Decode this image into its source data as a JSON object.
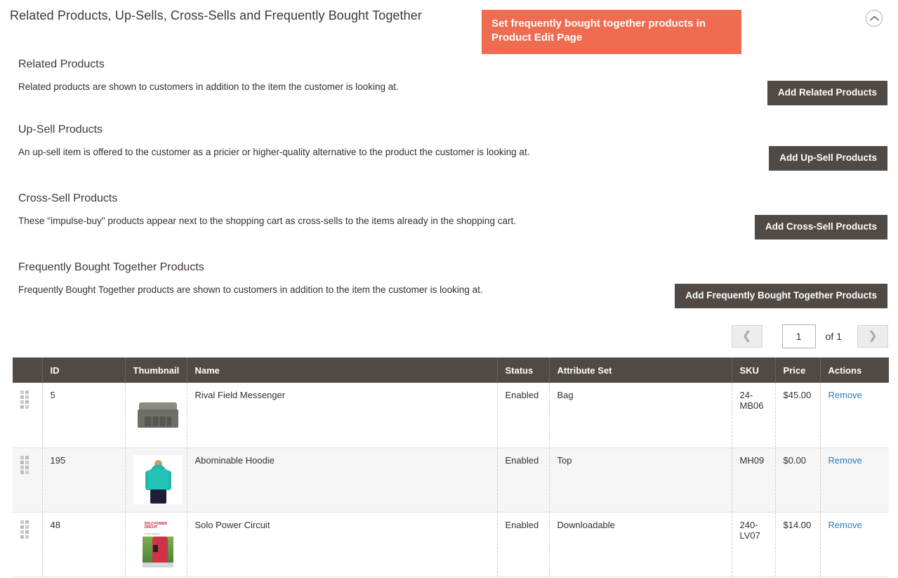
{
  "panel": {
    "title": "Related Products, Up-Sells, Cross-Sells and Frequently Bought Together",
    "collapse_icon": "chevron-up-circle-icon"
  },
  "callout": {
    "text": "Set frequently bought together products in Product Edit Page",
    "background": "#ef6c51",
    "text_color": "#ffffff"
  },
  "sections": [
    {
      "title": "Related Products",
      "description": "Related products are shown to customers in addition to the item the customer is looking at.",
      "button": "Add Related Products"
    },
    {
      "title": "Up-Sell Products",
      "description": "An up-sell item is offered to the customer as a pricier or higher-quality alternative to the product the customer is looking at.",
      "button": "Add Up-Sell Products"
    },
    {
      "title": "Cross-Sell Products",
      "description": "These \"impulse-buy\" products appear next to the shopping cart as cross-sells to the items already in the shopping cart.",
      "button": "Add Cross-Sell Products"
    },
    {
      "title": "Frequently Bought Together Products",
      "description": "Frequently Bought Together products are shown to customers in addition to the item the customer is looking at.",
      "button": "Add Frequently Bought Together Products"
    }
  ],
  "pagination": {
    "prev_icon": "chevron-left-icon",
    "next_icon": "chevron-right-icon",
    "current_page": "1",
    "of_label": "of 1",
    "total_pages": "1"
  },
  "table": {
    "columns": [
      "",
      "ID",
      "Thumbnail",
      "Name",
      "Status",
      "Attribute Set",
      "SKU",
      "Price",
      "Actions"
    ],
    "header_bg": "#514943",
    "rows": [
      {
        "drag": "drag-handle-icon",
        "id": "5",
        "thumbnail": "rival-field-messenger-thumbnail",
        "name": "Rival Field Messenger",
        "status": "Enabled",
        "attribute_set": "Bag",
        "sku": "24-MB06",
        "price": "$45.00",
        "action": "Remove"
      },
      {
        "drag": "drag-handle-icon",
        "id": "195",
        "thumbnail": "abominable-hoodie-thumbnail",
        "name": "Abominable Hoodie",
        "status": "Enabled",
        "attribute_set": "Top",
        "sku": "MH09",
        "price": "$0.00",
        "action": "Remove"
      },
      {
        "drag": "drag-handle-icon",
        "id": "48",
        "thumbnail": "solo-power-circuit-thumbnail",
        "name": "Solo Power Circuit",
        "status": "Enabled",
        "attribute_set": "Downloadable",
        "sku": "240-LV07",
        "price": "$14.00",
        "action": "Remove"
      }
    ]
  },
  "thumbnail_labels": {
    "dvd_title": "SOLO POWER CIRCUIT",
    "dvd_sub": "Fitness Program"
  },
  "colors": {
    "accent_dark": "#514943",
    "link": "#2e7dbb",
    "callout_orange": "#ef6c51"
  }
}
